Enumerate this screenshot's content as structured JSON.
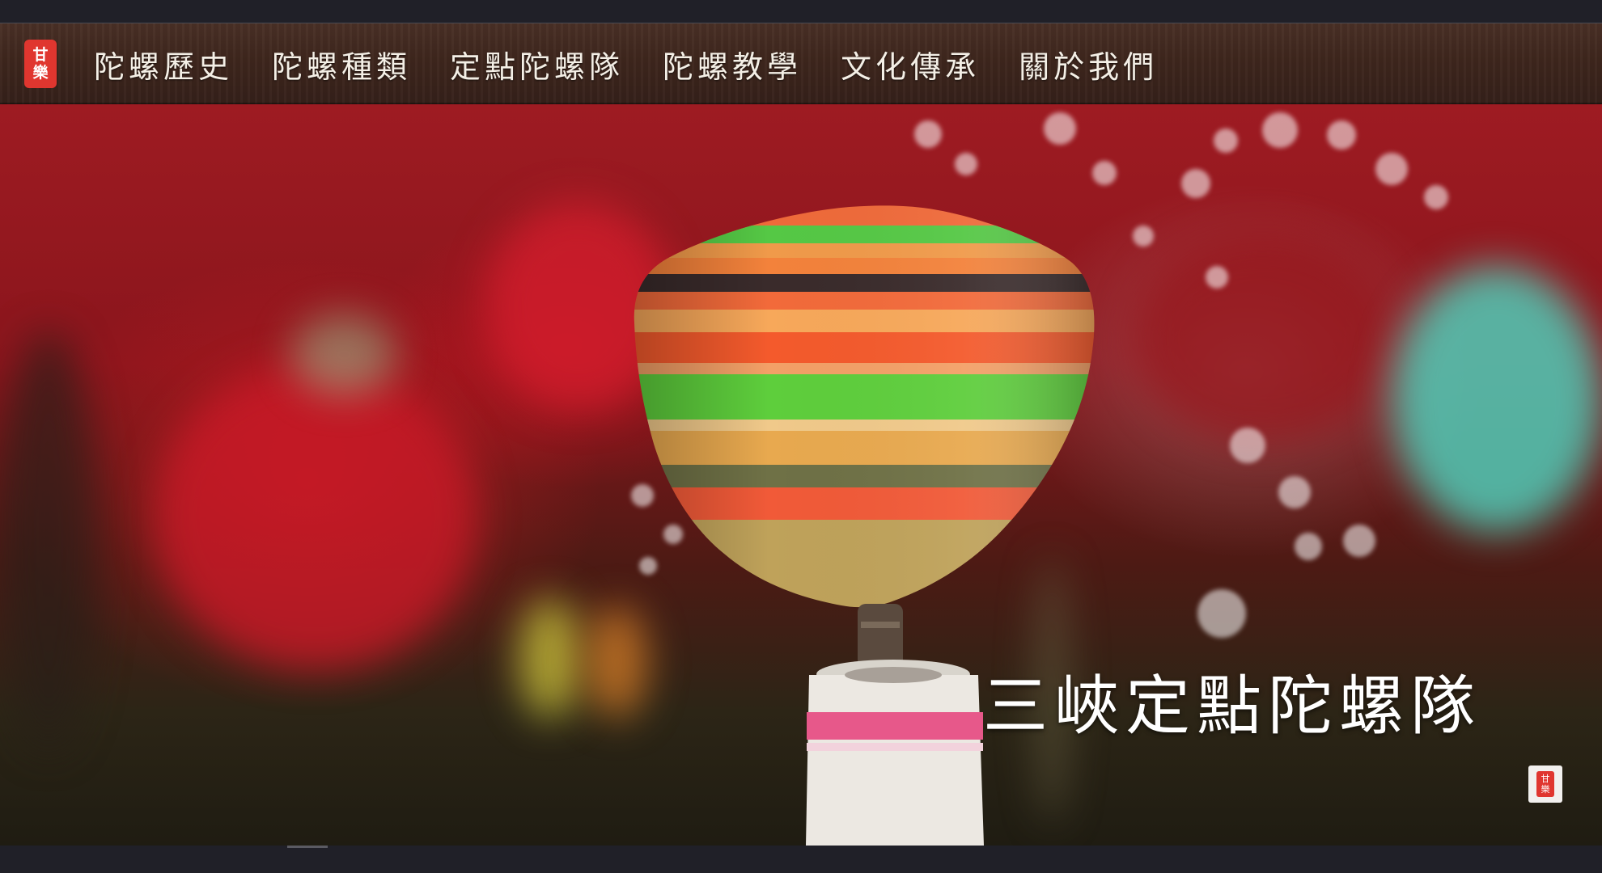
{
  "brand": {
    "logo_char_top": "甘",
    "logo_char_bottom": "樂",
    "color": "#e0362f"
  },
  "nav": {
    "items": [
      {
        "label": "陀螺歷史"
      },
      {
        "label": "陀螺種類"
      },
      {
        "label": "定點陀螺隊"
      },
      {
        "label": "陀螺教學"
      },
      {
        "label": "文化傳承"
      },
      {
        "label": "關於我們"
      }
    ]
  },
  "hero": {
    "title": "三峽定點陀螺隊",
    "image_subject": "spinning-top-icon"
  },
  "corner_stamp": {
    "char_top": "甘",
    "char_bottom": "樂"
  }
}
